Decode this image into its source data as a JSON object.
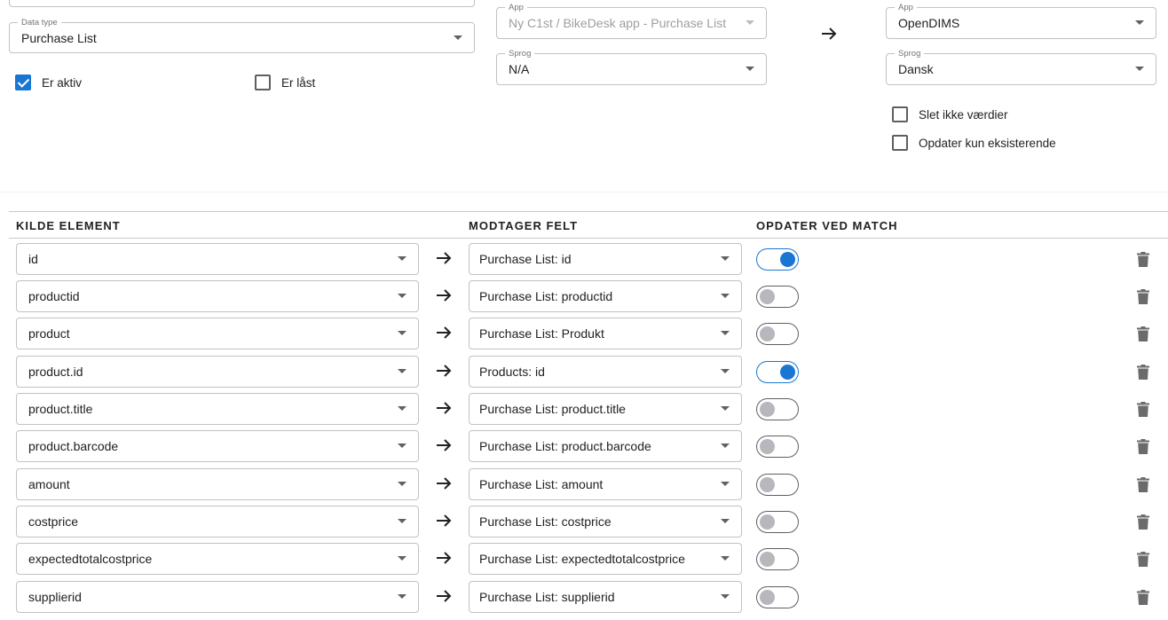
{
  "source": {
    "data_type": {
      "legend": "Data type",
      "value": "Purchase List"
    },
    "is_active": {
      "label": "Er aktiv",
      "checked": true
    },
    "is_locked": {
      "label": "Er låst",
      "checked": false
    }
  },
  "from": {
    "app": {
      "legend": "App",
      "value": "Ny C1st / BikeDesk app - Purchase List"
    },
    "language": {
      "legend": "Sprog",
      "value": "N/A"
    }
  },
  "to": {
    "app": {
      "legend": "App",
      "value": "OpenDIMS"
    },
    "language": {
      "legend": "Sprog",
      "value": "Dansk"
    },
    "dont_delete": {
      "label": "Slet ikke værdier",
      "checked": false
    },
    "update_existing_only": {
      "label": "Opdater kun eksisterende",
      "checked": false
    }
  },
  "table": {
    "headers": {
      "source": "KILDE ELEMENT",
      "target": "MODTAGER FELT",
      "update": "OPDATER VED MATCH"
    },
    "rows": [
      {
        "source": "id",
        "target": "Purchase List: id",
        "update": true
      },
      {
        "source": "productid",
        "target": "Purchase List: productid",
        "update": false
      },
      {
        "source": "product",
        "target": "Purchase List: Produkt",
        "update": false
      },
      {
        "source": "product.id",
        "target": "Products: id",
        "update": true
      },
      {
        "source": "product.title",
        "target": "Purchase List: product.title",
        "update": false
      },
      {
        "source": "product.barcode",
        "target": "Purchase List: product.barcode",
        "update": false
      },
      {
        "source": "amount",
        "target": "Purchase List: amount",
        "update": false
      },
      {
        "source": "costprice",
        "target": "Purchase List: costprice",
        "update": false
      },
      {
        "source": "expectedtotalcostprice",
        "target": "Purchase List: expectedtotalcostprice",
        "update": false
      },
      {
        "source": "supplierid",
        "target": "Purchase List: supplierid",
        "update": false
      }
    ]
  },
  "colors": {
    "accent": "#1976d2",
    "toggle_off_knob": "#b7b7bd",
    "border": "#c2c2c2"
  }
}
